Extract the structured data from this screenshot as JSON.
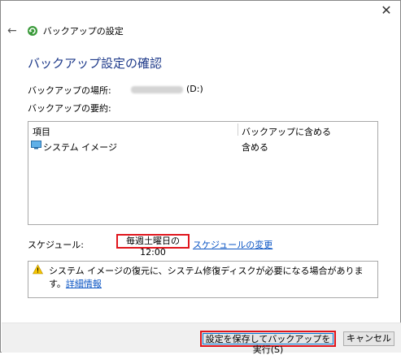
{
  "window": {
    "title": "バックアップの設定",
    "close_glyph": "✕",
    "back_glyph": "←"
  },
  "page": {
    "heading": "バックアップ設定の確認",
    "location_label": "バックアップの場所:",
    "location_value": "(D:)",
    "summary_label": "バックアップの要約:"
  },
  "summary_table": {
    "headers": {
      "item": "項目",
      "included": "バックアップに含める"
    },
    "rows": [
      {
        "item": "システム イメージ",
        "included": "含める"
      }
    ]
  },
  "schedule": {
    "label": "スケジュール:",
    "value": "毎週土曜日の 12:00",
    "change_link": "スケジュールの変更"
  },
  "warning": {
    "text": "システム イメージの復元に、システム修復ディスクが必要になる場合があります。",
    "link": "詳細情報"
  },
  "footer": {
    "save_run_label": "設定を保存してバックアップを実行(S)",
    "cancel_label": "キャンセル"
  },
  "colors": {
    "heading": "#1e3a8a",
    "link": "#0b55c4",
    "highlight": "#e0151c",
    "focus": "#0078d7"
  },
  "icons": {
    "back": "back-arrow-icon",
    "app": "backup-app-icon",
    "monitor": "monitor-icon",
    "warning": "warning-icon",
    "close": "close-icon"
  }
}
